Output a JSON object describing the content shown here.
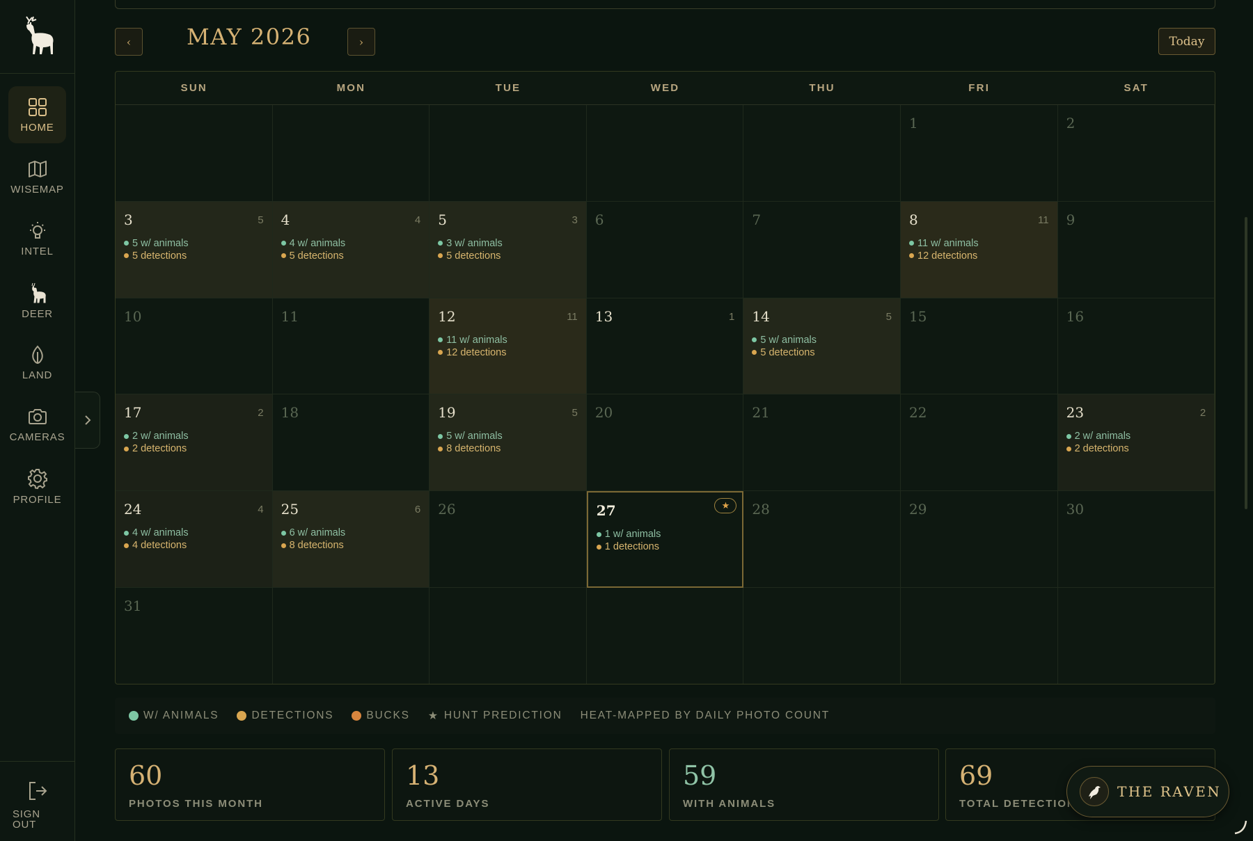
{
  "sidebar": {
    "items": [
      {
        "label": "HOME",
        "icon": "grid-icon"
      },
      {
        "label": "WISEMAP",
        "icon": "map-icon"
      },
      {
        "label": "INTEL",
        "icon": "lightbulb-icon"
      },
      {
        "label": "DEER",
        "icon": "deer-icon"
      },
      {
        "label": "LAND",
        "icon": "leaf-icon"
      },
      {
        "label": "CAMERAS",
        "icon": "camera-icon"
      },
      {
        "label": "PROFILE",
        "icon": "gear-icon"
      }
    ],
    "signout_label": "SIGN OUT"
  },
  "calendar": {
    "month_title": "MAY 2026",
    "prev_label": "‹",
    "next_label": "›",
    "today_label": "Today",
    "weekdays": [
      "SUN",
      "MON",
      "TUE",
      "WED",
      "THU",
      "FRI",
      "SAT"
    ],
    "days": [
      {
        "d": "",
        "c": "",
        "a": "",
        "t": ""
      },
      {
        "d": "",
        "c": "",
        "a": "",
        "t": ""
      },
      {
        "d": "",
        "c": "",
        "a": "",
        "t": ""
      },
      {
        "d": "",
        "c": "",
        "a": "",
        "t": ""
      },
      {
        "d": "",
        "c": "",
        "a": "",
        "t": ""
      },
      {
        "d": "1",
        "c": "",
        "a": "",
        "t": ""
      },
      {
        "d": "2",
        "c": "",
        "a": "",
        "t": ""
      },
      {
        "d": "3",
        "c": "5",
        "a": "5 w/ animals",
        "t": "5 detections",
        "heat": 2
      },
      {
        "d": "4",
        "c": "4",
        "a": "4 w/ animals",
        "t": "5 detections",
        "heat": 2
      },
      {
        "d": "5",
        "c": "3",
        "a": "3 w/ animals",
        "t": "5 detections",
        "heat": 2
      },
      {
        "d": "6",
        "c": "",
        "a": "",
        "t": ""
      },
      {
        "d": "7",
        "c": "",
        "a": "",
        "t": ""
      },
      {
        "d": "8",
        "c": "11",
        "a": "11 w/ animals",
        "t": "12 detections",
        "heat": 3
      },
      {
        "d": "9",
        "c": "",
        "a": "",
        "t": ""
      },
      {
        "d": "10",
        "c": "",
        "a": "",
        "t": ""
      },
      {
        "d": "11",
        "c": "",
        "a": "",
        "t": ""
      },
      {
        "d": "12",
        "c": "11",
        "a": "11 w/ animals",
        "t": "12 detections",
        "heat": 3
      },
      {
        "d": "13",
        "c": "1",
        "a": "",
        "t": ""
      },
      {
        "d": "14",
        "c": "5",
        "a": "5 w/ animals",
        "t": "5 detections",
        "heat": 2
      },
      {
        "d": "15",
        "c": "",
        "a": "",
        "t": ""
      },
      {
        "d": "16",
        "c": "",
        "a": "",
        "t": ""
      },
      {
        "d": "17",
        "c": "2",
        "a": "2 w/ animals",
        "t": "2 detections",
        "heat": 1
      },
      {
        "d": "18",
        "c": "",
        "a": "",
        "t": ""
      },
      {
        "d": "19",
        "c": "5",
        "a": "5 w/ animals",
        "t": "8 detections",
        "heat": 2
      },
      {
        "d": "20",
        "c": "",
        "a": "",
        "t": ""
      },
      {
        "d": "21",
        "c": "",
        "a": "",
        "t": ""
      },
      {
        "d": "22",
        "c": "",
        "a": "",
        "t": ""
      },
      {
        "d": "23",
        "c": "2",
        "a": "2 w/ animals",
        "t": "2 detections",
        "heat": 1
      },
      {
        "d": "24",
        "c": "4",
        "a": "4 w/ animals",
        "t": "4 detections",
        "heat": 1
      },
      {
        "d": "25",
        "c": "6",
        "a": "6 w/ animals",
        "t": "8 detections",
        "heat": 2
      },
      {
        "d": "26",
        "c": "",
        "a": "",
        "t": ""
      },
      {
        "d": "27",
        "c": "",
        "a": "1 w/ animals",
        "t": "1 detections",
        "today": true,
        "star": true
      },
      {
        "d": "28",
        "c": "",
        "a": "",
        "t": ""
      },
      {
        "d": "29",
        "c": "",
        "a": "",
        "t": ""
      },
      {
        "d": "30",
        "c": "",
        "a": "",
        "t": ""
      },
      {
        "d": "31",
        "c": "",
        "a": "",
        "t": ""
      },
      {
        "d": "",
        "c": "",
        "a": "",
        "t": ""
      },
      {
        "d": "",
        "c": "",
        "a": "",
        "t": ""
      },
      {
        "d": "",
        "c": "",
        "a": "",
        "t": ""
      },
      {
        "d": "",
        "c": "",
        "a": "",
        "t": ""
      },
      {
        "d": "",
        "c": "",
        "a": "",
        "t": ""
      },
      {
        "d": "",
        "c": "",
        "a": "",
        "t": ""
      }
    ]
  },
  "legend": {
    "animals": "W/ ANIMALS",
    "detections": "DETECTIONS",
    "bucks": "BUCKS",
    "hunt": "HUNT PREDICTION",
    "heatmap_note": "HEAT-MAPPED BY DAILY PHOTO COUNT"
  },
  "stats": [
    {
      "value": "60",
      "label": "PHOTOS THIS MONTH",
      "color": "#d6b274"
    },
    {
      "value": "13",
      "label": "ACTIVE DAYS",
      "color": "#d6b274"
    },
    {
      "value": "59",
      "label": "WITH ANIMALS",
      "color": "#8fc3a6"
    },
    {
      "value": "69",
      "label": "TOTAL DETECTIONS",
      "color": "#d6b274"
    }
  ],
  "raven": {
    "label": "THE RAVEN"
  },
  "colors": {
    "animals": "#7dc7a4",
    "detections": "#d9a650",
    "bucks": "#d9863e",
    "accent": "#d6b274",
    "background": "#0b150f"
  }
}
